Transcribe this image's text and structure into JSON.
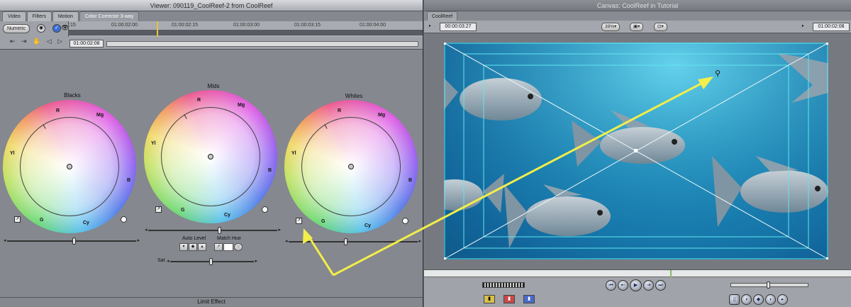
{
  "viewer": {
    "title": "Viewer: 090119_CoolReef-2 from CoolReef",
    "tabs": [
      "Video",
      "Filters",
      "Motion",
      "Color Corrector 3-way"
    ],
    "numeric_button": "Numeric",
    "ruler_ticks": [
      ";15",
      "01:00:02:00",
      "01:00:02:15",
      "01:00:03:00",
      "01:00:03:15",
      "01:00:04:00"
    ],
    "current_timecode": "01:00:02:08",
    "wheels": [
      {
        "name": "Blacks",
        "labels": {
          "r": "R",
          "mg": "Mg",
          "b": "B",
          "cy": "Cy",
          "g": "G",
          "yl": "Yl"
        }
      },
      {
        "name": "Mids",
        "labels": {
          "r": "R",
          "mg": "Mg",
          "b": "B",
          "cy": "Cy",
          "g": "G",
          "yl": "Yl"
        }
      },
      {
        "name": "Whites",
        "labels": {
          "r": "R",
          "mg": "Mg",
          "b": "B",
          "cy": "Cy",
          "g": "G",
          "yl": "Yl"
        }
      }
    ],
    "auto_level_label": "Auto Level",
    "match_hue_label": "Match Hue",
    "sat_label": "Sat",
    "limit_effect_label": "Limit Effect"
  },
  "canvas": {
    "title": "Canvas: CoolReef in Tutorial",
    "tab": "CoolReef",
    "timecode_left": "00:00:03:27",
    "timecode_right": "01:00:02:08",
    "zoom": "39%",
    "view_popup": "▣",
    "overlay_popup": "⊡"
  },
  "colors": {
    "annotation_arrow": "#f2ee4a",
    "wireframe": "#5fe6ef"
  }
}
